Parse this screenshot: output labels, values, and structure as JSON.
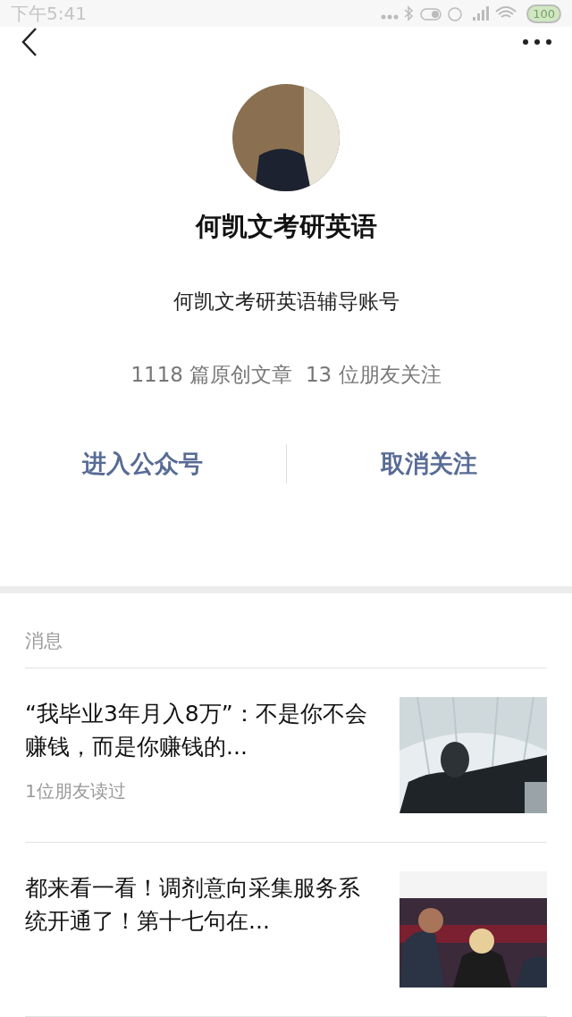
{
  "status_bar": {
    "time": "下午5:41",
    "battery": "100"
  },
  "profile": {
    "name": "何凯文考研英语",
    "description": "何凯文考研英语辅导账号",
    "stats": "1118 篇原创文章  13 位朋友关注"
  },
  "actions": [
    "进入公众号",
    "取消关注"
  ],
  "messages": {
    "heading": "消息",
    "items": [
      {
        "title": "“我毕业3年月入8万”：不是你不会赚钱，而是你赚钱的...",
        "meta": "1位朋友读过",
        "kind": "picture"
      },
      {
        "title": "都来看一看！调剂意向采集服务系统开通了！第十七句在...",
        "kind": "picture"
      }
    ]
  }
}
